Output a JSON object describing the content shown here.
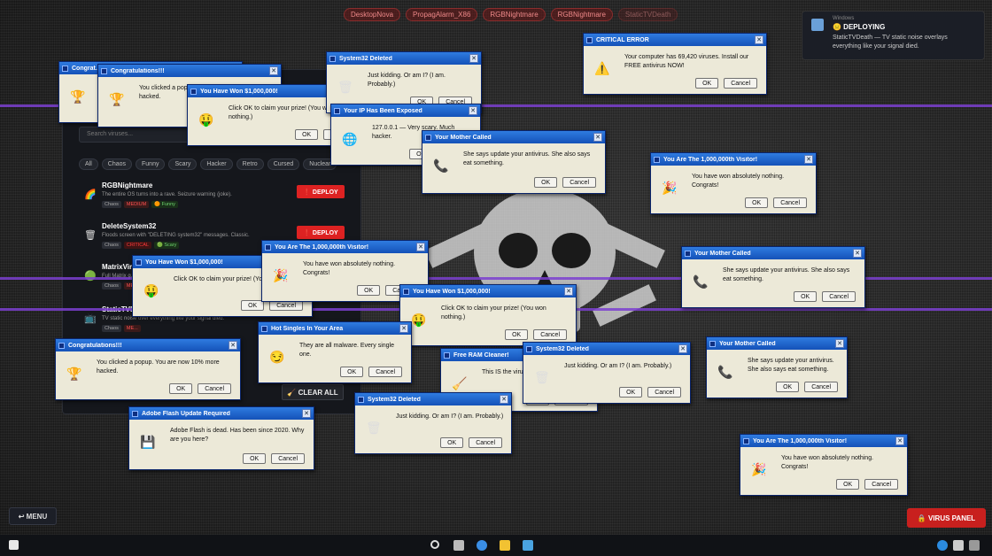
{
  "top_tags": [
    "DesktopNova",
    "PropagAlarm_X86",
    "RGBNightmare",
    "RGBNightmare",
    "StaticTVDeath"
  ],
  "notification": {
    "app": "Windows",
    "title": "😑 DEPLOYING",
    "body": "StaticTVDeath — TV static noise overlays everything like your signal died."
  },
  "panel": {
    "search_placeholder": "Search viruses...",
    "filters": [
      "All",
      "Chaos",
      "Funny",
      "Scary",
      "Hacker",
      "Retro",
      "Cursed",
      "Nuclear"
    ],
    "deploy_label": "❗ DEPLOY",
    "clear_all_label": "🧹 CLEAR ALL",
    "viruses": [
      {
        "icon": "🌈",
        "name": "RGBNightmare",
        "desc": "The entire OS turns into a rave. Seizure warning (joke).",
        "tags": [
          "Chaos",
          "MEDIUM",
          "🟠 Funny"
        ]
      },
      {
        "icon": "🗑",
        "name": "DeleteSystem32",
        "desc": "Floods screen with \"DELETING system32\" messages. Classic.",
        "tags": [
          "Chaos",
          "CRITICAL",
          "🟢 Scary"
        ]
      },
      {
        "icon": "🟢",
        "name": "MatrixVir...",
        "desc": "Full Matrix g...",
        "tags": [
          "Chaos",
          "ME..."
        ]
      },
      {
        "icon": "📺",
        "name": "StaticTVD...",
        "desc": "TV static noise over everything like your signal died.",
        "tags": [
          "Chaos",
          "ME..."
        ]
      }
    ]
  },
  "popups": [
    {
      "title": "Congrat...",
      "message": "",
      "ok": "",
      "cancel": "",
      "icon": "🏆"
    },
    {
      "title": "Congratulations!!!",
      "message": "You clicked a popup. You are now 10% more hacked.",
      "ok": "OK",
      "cancel": "Cancel",
      "icon": "🏆"
    },
    {
      "title": "You Have Won $1,000,000!",
      "message": "Click OK to claim your prize! (You won nothing.)",
      "ok": "OK",
      "cancel": "Cancel",
      "icon": "🤑"
    },
    {
      "title": "System32 Deleted",
      "message": "Just kidding. Or am I? (I am. Probably.)",
      "ok": "OK",
      "cancel": "Cancel",
      "icon": "🗑"
    },
    {
      "title": "Your IP Has Been Exposed",
      "message": "127.0.0.1 — Very scary. Much hacker.",
      "ok": "OK",
      "cancel": "Cancel",
      "icon": "🌐"
    },
    {
      "title": "Your Mother Called",
      "message": "She says update your antivirus. She also says eat something.",
      "ok": "OK",
      "cancel": "Cancel",
      "icon": "📞"
    },
    {
      "title": "CRITICAL ERROR",
      "message": "Your computer has 69,420 viruses. Install our FREE antivirus NOW!",
      "ok": "OK",
      "cancel": "Cancel",
      "icon": "⚠️"
    },
    {
      "title": "You Are The 1,000,000th Visitor!",
      "message": "You have won absolutely nothing. Congrats!",
      "ok": "OK",
      "cancel": "Cancel",
      "icon": "🎉"
    },
    {
      "title": "Your Mother Called",
      "message": "She says update your antivirus. She also says eat something.",
      "ok": "OK",
      "cancel": "Cancel",
      "icon": "📞"
    },
    {
      "title": "You Have Won $1,000,000!",
      "message": "Click OK to claim your prize! (You won nothing.)",
      "ok": "OK",
      "cancel": "Cancel",
      "icon": "🤑"
    },
    {
      "title": "You Are The 1,000,000th Visitor!",
      "message": "You have won absolutely nothing. Congrats!",
      "ok": "OK",
      "cancel": "Cancel",
      "icon": "🎉"
    },
    {
      "title": "You Have Won $1,000,000!",
      "message": "Click OK to claim your prize! (You won nothing.)",
      "ok": "OK",
      "cancel": "Cancel",
      "icon": "🤑"
    },
    {
      "title": "Congratulations!!!",
      "message": "You clicked a popup. You are now 10% more hacked.",
      "ok": "OK",
      "cancel": "Cancel",
      "icon": "🏆"
    },
    {
      "title": "Hot Singles In Your Area",
      "message": "They are all malware. Every single one.",
      "ok": "OK",
      "cancel": "Cancel",
      "icon": "😏"
    },
    {
      "title": "Your Mother Called",
      "message": "She says update your antivirus. She also says eat something.",
      "ok": "OK",
      "cancel": "Cancel",
      "icon": "📞"
    },
    {
      "title": "Free RAM Cleaner!",
      "message": "This IS the virus. Surprise!",
      "ok": "OK",
      "cancel": "Cancel",
      "icon": "🧹"
    },
    {
      "title": "System32 Deleted",
      "message": "Just kidding. Or am I? (I am. Probably.)",
      "ok": "OK",
      "cancel": "Cancel",
      "icon": "🗑"
    },
    {
      "title": "System32 Deleted",
      "message": "Just kidding. Or am I? (I am. Probably.)",
      "ok": "OK",
      "cancel": "Cancel",
      "icon": "🗑"
    },
    {
      "title": "Adobe Flash Update Required",
      "message": "Adobe Flash is dead. Has been since 2020. Why are you here?",
      "ok": "OK",
      "cancel": "Cancel",
      "icon": "💾"
    },
    {
      "title": "You Are The 1,000,000th Visitor!",
      "message": "You have won absolutely nothing. Congrats!",
      "ok": "OK",
      "cancel": "Cancel",
      "icon": "🎉"
    }
  ],
  "menu_label": "↩ MENU",
  "virus_panel_label": "🔒 VIRUS PANEL",
  "colors": {
    "accent_red": "#d22222",
    "titlebar_blue": "#1f63c8",
    "scanline_purple": "#7b3fd0"
  }
}
